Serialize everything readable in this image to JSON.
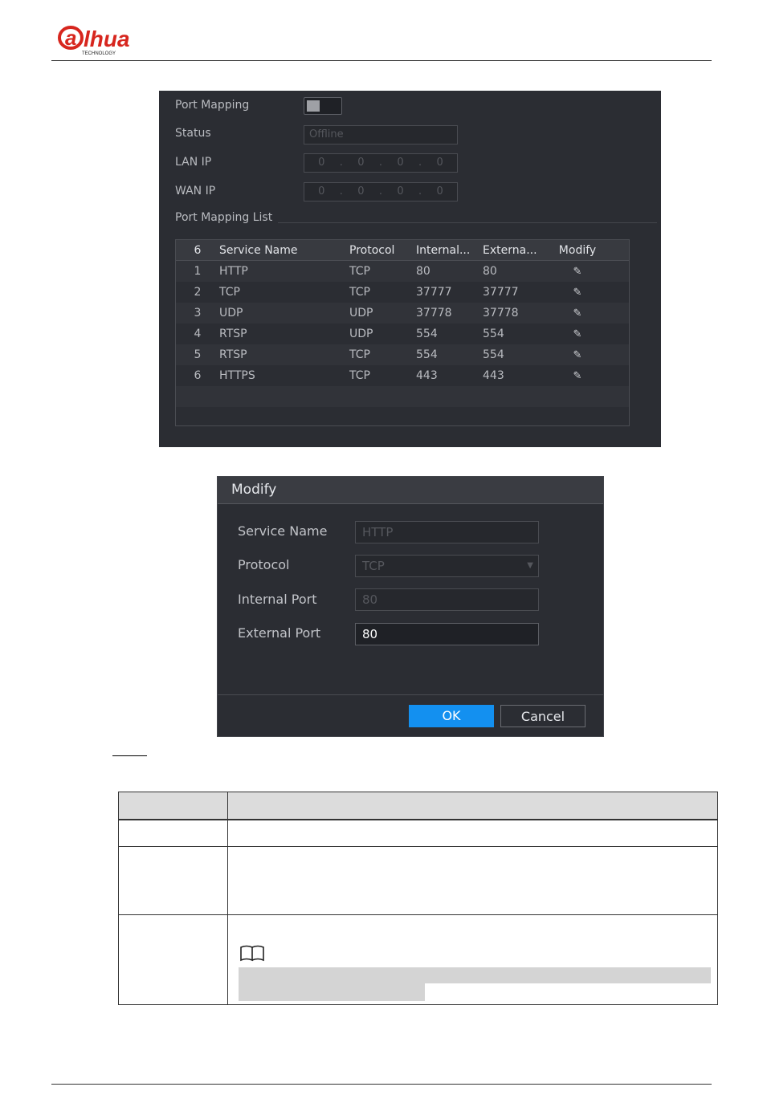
{
  "brand": {
    "logo_text": "alhua",
    "logo_sub": "TECHNOLOGY"
  },
  "panel": {
    "port_mapping_label": "Port Mapping",
    "port_mapping_enabled": false,
    "status_label": "Status",
    "status_value": "Offline",
    "lan_ip_label": "LAN IP",
    "lan_ip": [
      "0",
      "0",
      "0",
      "0"
    ],
    "wan_ip_label": "WAN IP",
    "wan_ip": [
      "0",
      "0",
      "0",
      "0"
    ],
    "list_title": "Port Mapping List",
    "table": {
      "headers": {
        "count": "6",
        "service_name": "Service Name",
        "protocol": "Protocol",
        "internal": "Internal...",
        "external": "Externa...",
        "modify": "Modify"
      },
      "rows": [
        {
          "num": "1",
          "name": "HTTP",
          "protocol": "TCP",
          "internal": "80",
          "external": "80"
        },
        {
          "num": "2",
          "name": "TCP",
          "protocol": "TCP",
          "internal": "37777",
          "external": "37777"
        },
        {
          "num": "3",
          "name": "UDP",
          "protocol": "UDP",
          "internal": "37778",
          "external": "37778"
        },
        {
          "num": "4",
          "name": "RTSP",
          "protocol": "UDP",
          "internal": "554",
          "external": "554"
        },
        {
          "num": "5",
          "name": "RTSP",
          "protocol": "TCP",
          "internal": "554",
          "external": "554"
        },
        {
          "num": "6",
          "name": "HTTPS",
          "protocol": "TCP",
          "internal": "443",
          "external": "443"
        }
      ]
    }
  },
  "dialog": {
    "title": "Modify",
    "service_name_label": "Service Name",
    "service_name_value": "HTTP",
    "protocol_label": "Protocol",
    "protocol_value": "TCP",
    "internal_port_label": "Internal Port",
    "internal_port_value": "80",
    "external_port_label": "External Port",
    "external_port_value": "80",
    "ok_label": "OK",
    "cancel_label": "Cancel"
  },
  "colors": {
    "panel_bg": "#2b2d33",
    "ok_button": "#1390f0",
    "brand_red": "#d7261e"
  }
}
